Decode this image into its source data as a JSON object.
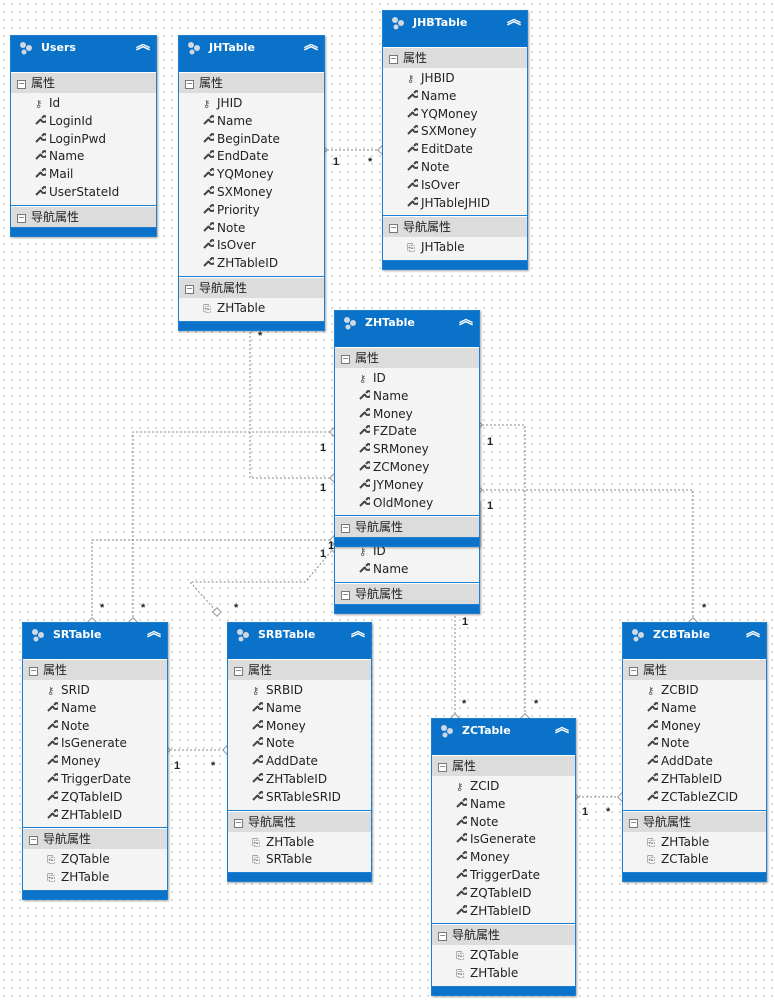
{
  "labels": {
    "properties": "属性",
    "navigation": "导航属性"
  },
  "colors": {
    "header": "#0a72c9",
    "section": "#dcdcdc",
    "body": "#f4f4f4",
    "connector": "#8a8a8a"
  },
  "entities": [
    {
      "id": "Users",
      "name": "Users",
      "properties": [
        {
          "name": "Id",
          "key": true
        },
        {
          "name": "LoginId"
        },
        {
          "name": "LoginPwd"
        },
        {
          "name": "Name"
        },
        {
          "name": "Mail"
        },
        {
          "name": "UserStateId"
        }
      ],
      "nav": []
    },
    {
      "id": "JHTable",
      "name": "JHTable",
      "properties": [
        {
          "name": "JHID",
          "key": true
        },
        {
          "name": "Name"
        },
        {
          "name": "BeginDate"
        },
        {
          "name": "EndDate"
        },
        {
          "name": "YQMoney"
        },
        {
          "name": "SXMoney"
        },
        {
          "name": "Priority"
        },
        {
          "name": "Note"
        },
        {
          "name": "IsOver"
        },
        {
          "name": "ZHTableID"
        }
      ],
      "nav": [
        "ZHTable"
      ]
    },
    {
      "id": "JHBTable",
      "name": "JHBTable",
      "properties": [
        {
          "name": "JHBID",
          "key": true
        },
        {
          "name": "Name"
        },
        {
          "name": "YQMoney"
        },
        {
          "name": "SXMoney"
        },
        {
          "name": "EditDate"
        },
        {
          "name": "Note"
        },
        {
          "name": "IsOver"
        },
        {
          "name": "JHTableJHID"
        }
      ],
      "nav": [
        "JHTable"
      ]
    },
    {
      "id": "Hidden",
      "name": "",
      "properties": [
        {
          "name": "ID",
          "key": true
        },
        {
          "name": "Name"
        }
      ],
      "nav": []
    },
    {
      "id": "ZHTable",
      "name": "ZHTable",
      "properties": [
        {
          "name": "ID",
          "key": true
        },
        {
          "name": "Name"
        },
        {
          "name": "Money"
        },
        {
          "name": "FZDate"
        },
        {
          "name": "SRMoney"
        },
        {
          "name": "ZCMoney"
        },
        {
          "name": "JYMoney"
        },
        {
          "name": "OldMoney"
        }
      ],
      "nav": []
    },
    {
      "id": "SRTable",
      "name": "SRTable",
      "properties": [
        {
          "name": "SRID",
          "key": true
        },
        {
          "name": "Name"
        },
        {
          "name": "Note"
        },
        {
          "name": "IsGenerate"
        },
        {
          "name": "Money"
        },
        {
          "name": "TriggerDate"
        },
        {
          "name": "ZQTableID"
        },
        {
          "name": "ZHTableID"
        }
      ],
      "nav": [
        "ZQTable",
        "ZHTable"
      ]
    },
    {
      "id": "SRBTable",
      "name": "SRBTable",
      "properties": [
        {
          "name": "SRBID",
          "key": true
        },
        {
          "name": "Name"
        },
        {
          "name": "Money"
        },
        {
          "name": "Note"
        },
        {
          "name": "AddDate"
        },
        {
          "name": "ZHTableID"
        },
        {
          "name": "SRTableSRID"
        }
      ],
      "nav": [
        "ZHTable",
        "SRTable"
      ]
    },
    {
      "id": "ZCTable",
      "name": "ZCTable",
      "properties": [
        {
          "name": "ZCID",
          "key": true
        },
        {
          "name": "Name"
        },
        {
          "name": "Note"
        },
        {
          "name": "IsGenerate"
        },
        {
          "name": "Money"
        },
        {
          "name": "TriggerDate"
        },
        {
          "name": "ZQTableID"
        },
        {
          "name": "ZHTableID"
        }
      ],
      "nav": [
        "ZQTable",
        "ZHTable"
      ]
    },
    {
      "id": "ZCBTable",
      "name": "ZCBTable",
      "properties": [
        {
          "name": "ZCBID",
          "key": true
        },
        {
          "name": "Name"
        },
        {
          "name": "Money"
        },
        {
          "name": "Note"
        },
        {
          "name": "AddDate"
        },
        {
          "name": "ZHTableID"
        },
        {
          "name": "ZCTableZCID"
        }
      ],
      "nav": [
        "ZHTable",
        "ZCTable"
      ]
    }
  ],
  "associations": [
    {
      "from": "JHTable",
      "to": "JHBTable",
      "from_mult": "1",
      "to_mult": "*"
    },
    {
      "from": "ZHTable",
      "to": "JHTable",
      "from_mult": "1",
      "to_mult": "*"
    },
    {
      "from": "ZHTable",
      "to": "SRTable",
      "from_mult": "1",
      "to_mult": "*"
    },
    {
      "from": "ZHTable",
      "to": "SRTable",
      "from_mult": "1",
      "to_mult": "*"
    },
    {
      "from": "ZHTable",
      "to": "SRBTable",
      "from_mult": "1",
      "to_mult": "*"
    },
    {
      "from": "SRTable",
      "to": "SRBTable",
      "from_mult": "1",
      "to_mult": "*"
    },
    {
      "from": "ZHTable",
      "to": "ZCTable",
      "from_mult": "1",
      "to_mult": "*"
    },
    {
      "from": "ZHTable",
      "to": "ZCTable",
      "from_mult": "1",
      "to_mult": "*"
    },
    {
      "from": "ZHTable",
      "to": "ZCBTable",
      "from_mult": "1",
      "to_mult": "*"
    },
    {
      "from": "ZCTable",
      "to": "ZCBTable",
      "from_mult": "1",
      "to_mult": "*"
    }
  ]
}
